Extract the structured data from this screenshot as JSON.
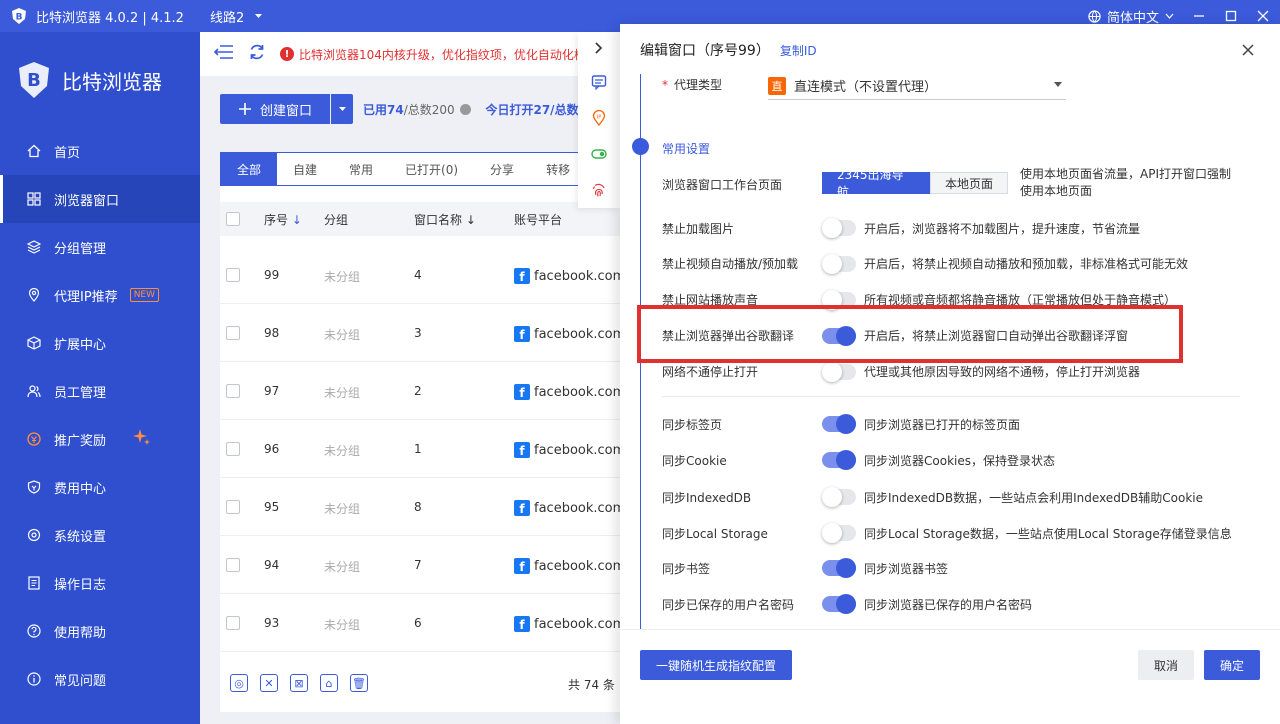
{
  "titlebar": {
    "title": "比特浏览器 4.0.2 | 4.1.2",
    "route": "线路2",
    "language": "简体中文"
  },
  "sidebar": {
    "brand": "比特浏览器",
    "items": [
      {
        "label": "首页",
        "icon": "home-icon"
      },
      {
        "label": "浏览器窗口",
        "icon": "grid-icon"
      },
      {
        "label": "分组管理",
        "icon": "layers-icon"
      },
      {
        "label": "代理IP推荐",
        "icon": "location-icon",
        "badge": "NEW"
      },
      {
        "label": "扩展中心",
        "icon": "box-icon"
      },
      {
        "label": "员工管理",
        "icon": "users-icon"
      },
      {
        "label": "推广奖励",
        "icon": "reward-icon"
      },
      {
        "label": "费用中心",
        "icon": "shield-icon"
      },
      {
        "label": "系统设置",
        "icon": "gear-icon"
      },
      {
        "label": "操作日志",
        "icon": "log-icon"
      },
      {
        "label": "使用帮助",
        "icon": "help-icon"
      },
      {
        "label": "常见问题",
        "icon": "info-icon"
      }
    ]
  },
  "topbar": {
    "notice": "比特浏览器104内核升级，优化指纹项，优化自动化校"
  },
  "toolbar": {
    "create_label": "创建窗口",
    "used": "已用74",
    "total": "/总数200",
    "today": "今日打开27/总数2"
  },
  "table": {
    "tabs": [
      "全部",
      "自建",
      "常用",
      "已打开(0)",
      "分享",
      "转移"
    ],
    "headers": {
      "no": "序号",
      "group": "分组",
      "name": "窗口名称",
      "platform": "账号平台"
    },
    "rows": [
      {
        "no": "99",
        "group": "未分组",
        "name": "4",
        "platform": "facebook.com"
      },
      {
        "no": "98",
        "group": "未分组",
        "name": "3",
        "platform": "facebook.com"
      },
      {
        "no": "97",
        "group": "未分组",
        "name": "2",
        "platform": "facebook.com"
      },
      {
        "no": "96",
        "group": "未分组",
        "name": "1",
        "platform": "facebook.com"
      },
      {
        "no": "95",
        "group": "未分组",
        "name": "8",
        "platform": "facebook.com"
      },
      {
        "no": "94",
        "group": "未分组",
        "name": "7",
        "platform": "facebook.com"
      },
      {
        "no": "93",
        "group": "未分组",
        "name": "6",
        "platform": "facebook.com"
      }
    ],
    "total": "共 74 条"
  },
  "drawer": {
    "title": "编辑窗口（序号99）",
    "copy_id": "复制ID",
    "proxy_label": "代理类型",
    "proxy_badge": "直",
    "proxy_value": "直连模式（不设置代理）",
    "section": "常用设置",
    "workbench_label": "浏览器窗口工作台页面",
    "workbench_opt1": "2345出海导航",
    "workbench_opt2": "本地页面",
    "workbench_desc": "使用本地页面省流量，API打开窗口强制使用本地页面",
    "settings": [
      {
        "label": "禁止加载图片",
        "desc": "开启后，浏览器将不加载图片，提升速度，节省流量",
        "on": false
      },
      {
        "label": "禁止视频自动播放/预加载",
        "desc": "开启后，将禁止视频自动播放和预加载，非标准格式可能无效",
        "on": false
      },
      {
        "label": "禁止网站播放声音",
        "desc": "所有视频或音频都将静音播放（正常播放但处于静音模式）",
        "on": false
      },
      {
        "label": "禁止浏览器弹出谷歌翻译",
        "desc": "开启后，将禁止浏览器窗口自动弹出谷歌翻译浮窗",
        "on": true
      },
      {
        "label": "网络不通停止打开",
        "desc": "代理或其他原因导致的网络不通畅，停止打开浏览器",
        "on": false
      }
    ],
    "sync": [
      {
        "label": "同步标签页",
        "desc": "同步浏览器已打开的标签页面",
        "on": true
      },
      {
        "label": "同步Cookie",
        "desc": "同步浏览器Cookies，保持登录状态",
        "on": true
      },
      {
        "label": "同步IndexedDB",
        "desc": "同步IndexedDB数据，一些站点会利用IndexedDB辅助Cookie",
        "on": false
      },
      {
        "label": "同步Local Storage",
        "desc": "同步Local Storage数据，一些站点使用Local Storage存储登录信息",
        "on": false
      },
      {
        "label": "同步书签",
        "desc": "同步浏览器书签",
        "on": true
      },
      {
        "label": "同步已保存的用户名密码",
        "desc": "同步浏览器已保存的用户名密码",
        "on": true
      }
    ],
    "generate_btn": "一键随机生成指纹配置",
    "cancel_btn": "取消",
    "ok_btn": "确定"
  },
  "colors": {
    "primary": "#3b5bdb",
    "sidebar": "#2f4fce",
    "danger": "#e03131"
  }
}
